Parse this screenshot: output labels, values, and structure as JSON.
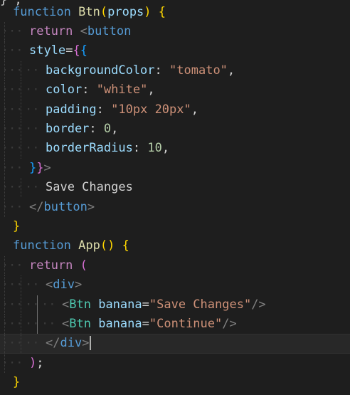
{
  "editor": {
    "top_clip": "} ;",
    "lines": [
      {
        "tokens": [
          {
            "t": "function",
            "c": "kw"
          },
          {
            "t": " ",
            "c": "punc"
          },
          {
            "t": "Btn",
            "c": "fn"
          },
          {
            "t": "(",
            "c": "br1"
          },
          {
            "t": "props",
            "c": "var"
          },
          {
            "t": ")",
            "c": "br1"
          },
          {
            "t": " ",
            "c": "punc"
          },
          {
            "t": "{",
            "c": "br1"
          }
        ]
      },
      {
        "tokens": [
          {
            "t": "return",
            "c": "ctl"
          },
          {
            "t": " ",
            "c": "punc"
          },
          {
            "t": "<",
            "c": "tag"
          },
          {
            "t": "button",
            "c": "tagname"
          }
        ]
      },
      {
        "tokens": [
          {
            "t": "style",
            "c": "var"
          },
          {
            "t": "=",
            "c": "punc"
          },
          {
            "t": "{",
            "c": "br2"
          },
          {
            "t": "{",
            "c": "br3"
          }
        ]
      },
      {
        "tokens": [
          {
            "t": "backgroundColor",
            "c": "var"
          },
          {
            "t": ":",
            "c": "punc"
          },
          {
            "t": " ",
            "c": "punc"
          },
          {
            "t": "\"tomato\"",
            "c": "str"
          },
          {
            "t": ",",
            "c": "punc"
          }
        ]
      },
      {
        "tokens": [
          {
            "t": "color",
            "c": "var"
          },
          {
            "t": ":",
            "c": "punc"
          },
          {
            "t": " ",
            "c": "punc"
          },
          {
            "t": "\"white\"",
            "c": "str"
          },
          {
            "t": ",",
            "c": "punc"
          }
        ]
      },
      {
        "tokens": [
          {
            "t": "padding",
            "c": "var"
          },
          {
            "t": ":",
            "c": "punc"
          },
          {
            "t": " ",
            "c": "punc"
          },
          {
            "t": "\"10px 20px\"",
            "c": "str"
          },
          {
            "t": ",",
            "c": "punc"
          }
        ]
      },
      {
        "tokens": [
          {
            "t": "border",
            "c": "var"
          },
          {
            "t": ":",
            "c": "punc"
          },
          {
            "t": " ",
            "c": "punc"
          },
          {
            "t": "0",
            "c": "num"
          },
          {
            "t": ",",
            "c": "punc"
          }
        ]
      },
      {
        "tokens": [
          {
            "t": "borderRadius",
            "c": "var"
          },
          {
            "t": ":",
            "c": "punc"
          },
          {
            "t": " ",
            "c": "punc"
          },
          {
            "t": "10",
            "c": "num"
          },
          {
            "t": ",",
            "c": "punc"
          }
        ]
      },
      {
        "tokens": [
          {
            "t": "}",
            "c": "br3"
          },
          {
            "t": "}",
            "c": "br2"
          },
          {
            "t": ">",
            "c": "tag"
          }
        ]
      },
      {
        "tokens": [
          {
            "t": "Save Changes",
            "c": "txt"
          }
        ]
      },
      {
        "tokens": [
          {
            "t": "</",
            "c": "tag"
          },
          {
            "t": "button",
            "c": "tagname"
          },
          {
            "t": ">",
            "c": "tag"
          }
        ]
      },
      {
        "tokens": [
          {
            "t": "}",
            "c": "br1"
          }
        ]
      },
      {
        "tokens": [
          {
            "t": "function",
            "c": "kw"
          },
          {
            "t": " ",
            "c": "punc"
          },
          {
            "t": "App",
            "c": "fn"
          },
          {
            "t": "(",
            "c": "br1"
          },
          {
            "t": ")",
            "c": "br1"
          },
          {
            "t": " ",
            "c": "punc"
          },
          {
            "t": "{",
            "c": "br1"
          }
        ]
      },
      {
        "tokens": [
          {
            "t": "return",
            "c": "ctl"
          },
          {
            "t": " ",
            "c": "punc"
          },
          {
            "t": "(",
            "c": "br2"
          }
        ]
      },
      {
        "tokens": [
          {
            "t": "<",
            "c": "tag"
          },
          {
            "t": "div",
            "c": "tagname"
          },
          {
            "t": ">",
            "c": "tag"
          }
        ]
      },
      {
        "tokens": [
          {
            "t": "<",
            "c": "tag"
          },
          {
            "t": "Btn",
            "c": "comp"
          },
          {
            "t": " ",
            "c": "punc"
          },
          {
            "t": "banana",
            "c": "var"
          },
          {
            "t": "=",
            "c": "punc"
          },
          {
            "t": "\"Save Changes\"",
            "c": "str"
          },
          {
            "t": "/>",
            "c": "tag"
          }
        ]
      },
      {
        "tokens": [
          {
            "t": "<",
            "c": "tag"
          },
          {
            "t": "Btn",
            "c": "comp"
          },
          {
            "t": " ",
            "c": "punc"
          },
          {
            "t": "banana",
            "c": "var"
          },
          {
            "t": "=",
            "c": "punc"
          },
          {
            "t": "\"Continue\"",
            "c": "str"
          },
          {
            "t": "/>",
            "c": "tag"
          }
        ]
      },
      {
        "tokens": [
          {
            "t": "</",
            "c": "tag"
          },
          {
            "t": "div",
            "c": "tagname"
          },
          {
            "t": ">",
            "c": "tag"
          }
        ],
        "cursor": true,
        "current": true
      },
      {
        "tokens": [
          {
            "t": ")",
            "c": "br2"
          },
          {
            "t": ";",
            "c": "punc"
          }
        ]
      },
      {
        "tokens": [
          {
            "t": "}",
            "c": "br1"
          }
        ]
      }
    ]
  },
  "theme": {
    "background": "#1e1e1e",
    "keyword": "#569cd6",
    "control": "#c586c0",
    "function": "#dcdcaa",
    "variable": "#9cdcfe",
    "string": "#ce9178",
    "number": "#b5cea8",
    "component": "#4ec9b0",
    "bracket_1": "#ffd700",
    "bracket_2": "#da70d6",
    "bracket_3": "#179fff"
  }
}
